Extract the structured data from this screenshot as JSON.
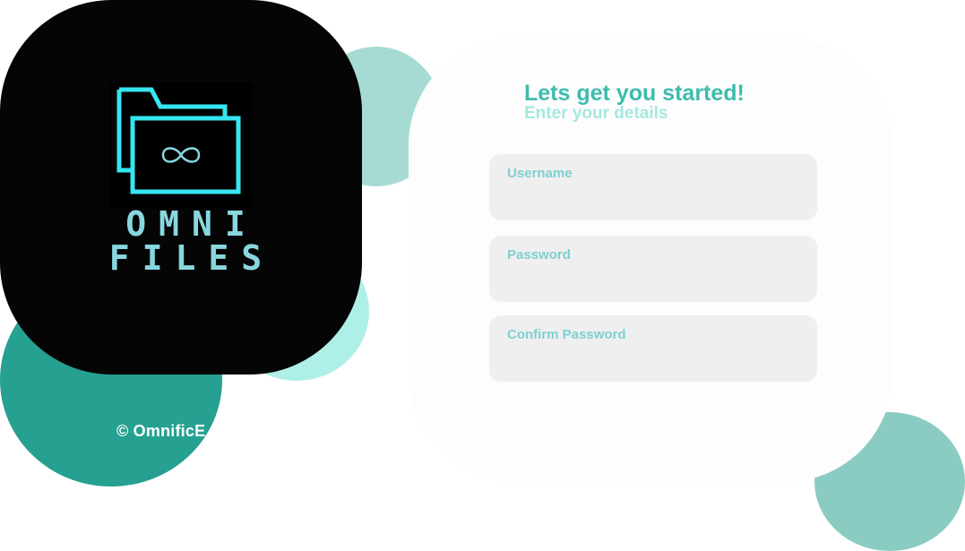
{
  "brand": {
    "logo_line1": "OMNI",
    "logo_line2": "FILES",
    "copyright": "© OmnificE"
  },
  "signup": {
    "heading": "Lets get you started!",
    "subheading": "Enter your details",
    "fields": [
      {
        "label": "Username",
        "value": "",
        "type": "text"
      },
      {
        "label": "Password",
        "value": "",
        "type": "password"
      },
      {
        "label": "Confirm Password",
        "value": "",
        "type": "password"
      }
    ]
  },
  "colors": {
    "accent_teal": "#3dbcad",
    "accent_light": "#a6e8e1",
    "logo_cyan": "#35e6f1",
    "logo_text": "#88d7df",
    "blob_dark": "#26a091",
    "blob_mid": "#a6dbd3",
    "blob_light": "#aef0e8",
    "blob_right": "#8acbc2",
    "field_bg": "#efefef",
    "logo_bg": "#050505"
  },
  "icons": {
    "logo": "folder-infinity-icon"
  }
}
